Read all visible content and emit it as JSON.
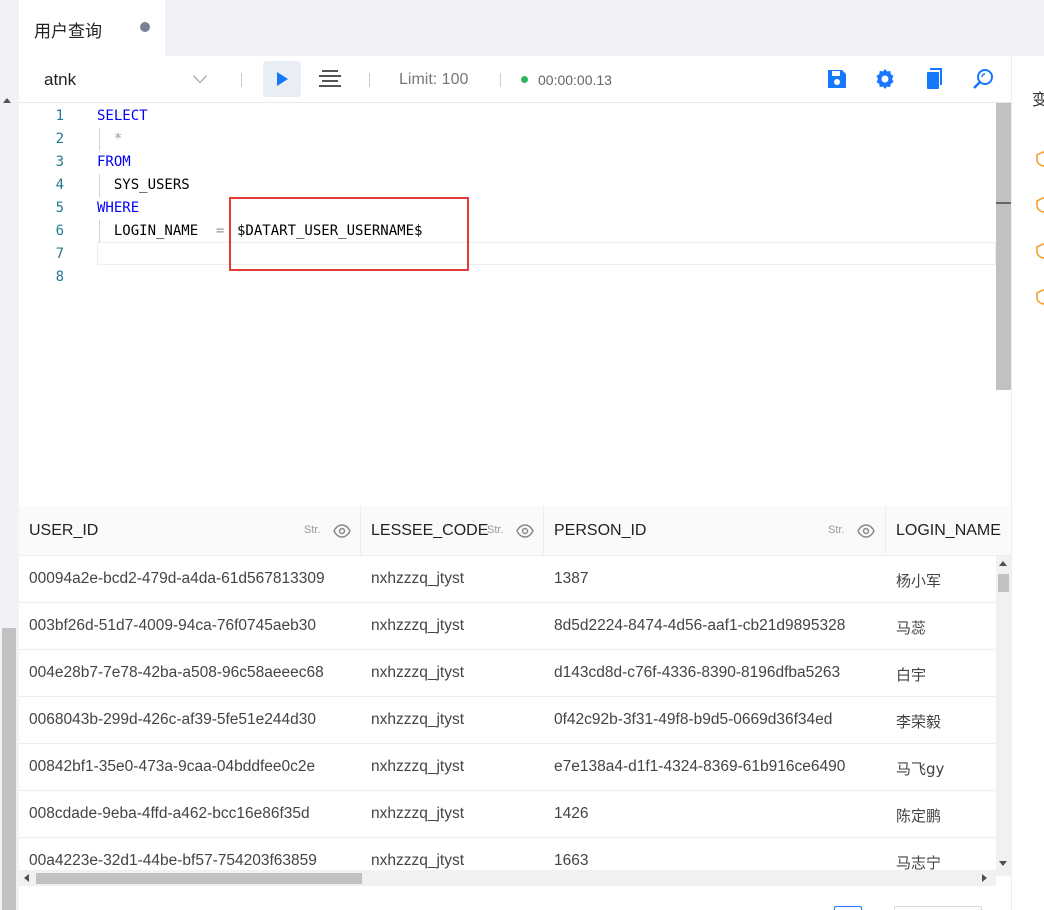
{
  "tab": {
    "title": "用户查询"
  },
  "toolbar": {
    "source": "atnk",
    "limit": "Limit: 100",
    "duration": "00:00:00.13",
    "status_color": "#2db55d",
    "icons": [
      "save-icon",
      "settings-icon",
      "copy-icon",
      "search-icon"
    ]
  },
  "editor": {
    "lines": [
      {
        "num": "1",
        "keyword": "SELECT",
        "text": ""
      },
      {
        "num": "2",
        "keyword": "",
        "text": "  *"
      },
      {
        "num": "3",
        "keyword": "FROM",
        "text": ""
      },
      {
        "num": "4",
        "keyword": "",
        "text": "  SYS_USERS"
      },
      {
        "num": "5",
        "keyword": "WHERE",
        "text": ""
      },
      {
        "num": "6",
        "keyword": "",
        "text": "  LOGIN_NAME",
        "op": "=",
        "value": "$DATART_USER_USERNAME$"
      },
      {
        "num": "7",
        "keyword": "",
        "text": ""
      },
      {
        "num": "8",
        "keyword": "",
        "text": ""
      }
    ]
  },
  "table": {
    "columns": [
      {
        "label": "USER_ID",
        "type": "Str."
      },
      {
        "label": "LESSEE_CODE",
        "type": "Str."
      },
      {
        "label": "PERSON_ID",
        "type": "Str."
      },
      {
        "label": "LOGIN_NAME",
        "type": ""
      }
    ],
    "rows": [
      [
        "00094a2e-bcd2-479d-a4da-61d567813309",
        "nxhzzzq_jtyst",
        "1387",
        "杨小军"
      ],
      [
        "003bf26d-51d7-4009-94ca-76f0745aeb30",
        "nxhzzzq_jtyst",
        "8d5d2224-8474-4d56-aaf1-cb21d9895328",
        "马蕊"
      ],
      [
        "004e28b7-7e78-42ba-a508-96c58aeeec68",
        "nxhzzzq_jtyst",
        "d143cd8d-c76f-4336-8390-8196dfba5263",
        "白宇"
      ],
      [
        "0068043b-299d-426c-af39-5fe51e244d30",
        "nxhzzzq_jtyst",
        "0f42c92b-3f31-49f8-b9d5-0669d36f34ed",
        "李荣毅"
      ],
      [
        "00842bf1-35e0-473a-9caa-04bddfee0c2e",
        "nxhzzzq_jtyst",
        "e7e138a4-d1f1-4324-8369-61b916ce6490",
        "马飞gy"
      ],
      [
        "008cdade-9eba-4ffd-a462-bcc16e86f35d",
        "nxhzzzq_jtyst",
        "1426",
        "陈定鹏"
      ],
      [
        "00a4223e-32d1-44be-bf57-754203f63859",
        "nxhzzzq_jtyst",
        "1663",
        "马志宁"
      ]
    ]
  },
  "right_panel": {
    "title": "变"
  }
}
